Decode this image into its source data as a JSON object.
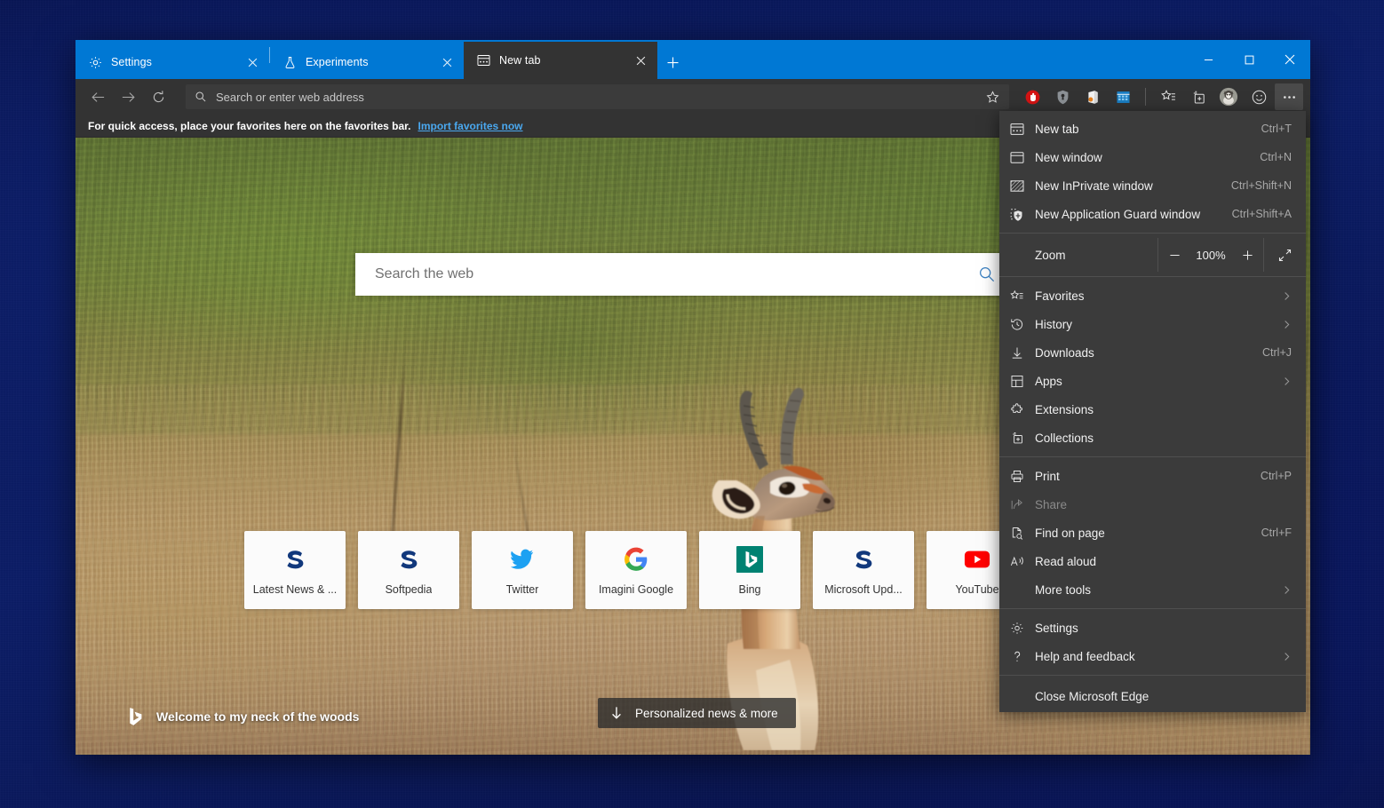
{
  "window": {
    "controls": {
      "minimize": "minimize-button",
      "maximize": "maximize-button",
      "close": "close-button"
    }
  },
  "tabs": [
    {
      "icon": "gear-icon",
      "label": "Settings",
      "active": false
    },
    {
      "icon": "flask-icon",
      "label": "Experiments",
      "active": false
    },
    {
      "icon": "newtab-page-icon",
      "label": "New tab",
      "active": true
    }
  ],
  "newtab_button_label": "+",
  "toolbar": {
    "back": "back-arrow-icon",
    "forward": "forward-arrow-icon",
    "refresh": "refresh-icon",
    "address_placeholder": "Search or enter web address",
    "address_value": "",
    "favorite_star": "star-outline-icon",
    "extensions": [
      {
        "name": "adblock-extension-icon",
        "color": "#e02020"
      },
      {
        "name": "password-manager-extension-icon",
        "color": "#9aa0a6"
      },
      {
        "name": "office-extension-icon",
        "color": "#e8811c"
      },
      {
        "name": "calendar-extension-icon",
        "color": "#2a8fd6"
      }
    ],
    "favorites_icon": "favorites-star-list-icon",
    "collections_icon": "collections-icon",
    "profile_icon": "profile-avatar-icon",
    "feedback_icon": "smiley-feedback-icon",
    "settings_more_icon": "more-ellipsis-icon"
  },
  "favorites_bar": {
    "message": "For quick access, place your favorites here on the favorites bar.",
    "link": "Import favorites now",
    "link_color": "#4aa8ef"
  },
  "newtab_page": {
    "search_placeholder": "Search the web",
    "search_icon": "magnifier-icon",
    "tiles": [
      {
        "label": "Latest News & ...",
        "icon": "softpedia-s-logo",
        "color": "#11387c"
      },
      {
        "label": "Softpedia",
        "icon": "softpedia-s-logo",
        "color": "#11387c"
      },
      {
        "label": "Twitter",
        "icon": "twitter-bird-logo",
        "color": "#1da1f2"
      },
      {
        "label": "Imagini Google",
        "icon": "google-g-logo",
        "color": "#4285f4"
      },
      {
        "label": "Bing",
        "icon": "bing-b-logo",
        "color": "#008272"
      },
      {
        "label": "Microsoft Upd...",
        "icon": "softpedia-s-logo",
        "color": "#11387c"
      },
      {
        "label": "YouTube",
        "icon": "youtube-play-logo",
        "color": "#ff0000"
      }
    ],
    "welcome_text": "Welcome to my neck of the woods",
    "welcome_icon": "bing-b-logo",
    "news_button": "Personalized news & more",
    "news_button_icon": "down-arrow-icon"
  },
  "settings_menu": {
    "groups": [
      {
        "items": [
          {
            "icon": "newtab-page-icon",
            "label": "New tab",
            "shortcut": "Ctrl+T",
            "chevron": false,
            "disabled": false
          },
          {
            "icon": "new-window-icon",
            "label": "New window",
            "shortcut": "Ctrl+N",
            "chevron": false,
            "disabled": false
          },
          {
            "icon": "inprivate-window-icon",
            "label": "New InPrivate window",
            "shortcut": "Ctrl+Shift+N",
            "chevron": false,
            "disabled": false
          },
          {
            "icon": "application-guard-icon",
            "label": "New Application Guard window",
            "shortcut": "Ctrl+Shift+A",
            "chevron": false,
            "disabled": false
          }
        ]
      },
      {
        "zoom": {
          "label": "Zoom",
          "minus": "minus-icon",
          "value": "100%",
          "plus": "plus-icon",
          "fullscreen": "fullscreen-icon"
        }
      },
      {
        "items": [
          {
            "icon": "favorites-star-list-icon",
            "label": "Favorites",
            "shortcut": "",
            "chevron": true,
            "disabled": false
          },
          {
            "icon": "history-clock-icon",
            "label": "History",
            "shortcut": "",
            "chevron": true,
            "disabled": false
          },
          {
            "icon": "downloads-arrow-icon",
            "label": "Downloads",
            "shortcut": "Ctrl+J",
            "chevron": false,
            "disabled": false
          },
          {
            "icon": "apps-grid-icon",
            "label": "Apps",
            "shortcut": "",
            "chevron": true,
            "disabled": false
          },
          {
            "icon": "extensions-puzzle-icon",
            "label": "Extensions",
            "shortcut": "",
            "chevron": false,
            "disabled": false
          },
          {
            "icon": "collections-icon",
            "label": "Collections",
            "shortcut": "",
            "chevron": false,
            "disabled": false
          }
        ]
      },
      {
        "items": [
          {
            "icon": "print-icon",
            "label": "Print",
            "shortcut": "Ctrl+P",
            "chevron": false,
            "disabled": false
          },
          {
            "icon": "share-icon",
            "label": "Share",
            "shortcut": "",
            "chevron": false,
            "disabled": true
          },
          {
            "icon": "find-on-page-icon",
            "label": "Find on page",
            "shortcut": "Ctrl+F",
            "chevron": false,
            "disabled": false
          },
          {
            "icon": "read-aloud-icon",
            "label": "Read aloud",
            "shortcut": "",
            "chevron": false,
            "disabled": false
          },
          {
            "icon": "",
            "label": "More tools",
            "shortcut": "",
            "chevron": true,
            "disabled": false
          }
        ]
      },
      {
        "items": [
          {
            "icon": "gear-icon",
            "label": "Settings",
            "shortcut": "",
            "chevron": false,
            "disabled": false
          },
          {
            "icon": "help-question-icon",
            "label": "Help and feedback",
            "shortcut": "",
            "chevron": true,
            "disabled": false
          }
        ]
      },
      {
        "items": [
          {
            "icon": "",
            "label": "Close Microsoft Edge",
            "shortcut": "",
            "chevron": false,
            "disabled": false
          }
        ]
      }
    ]
  },
  "colors": {
    "titlebar_blue": "#0078d4",
    "chrome_gray": "#333333",
    "menu_gray": "#3b3b3b",
    "link_blue": "#4aa8ef"
  }
}
